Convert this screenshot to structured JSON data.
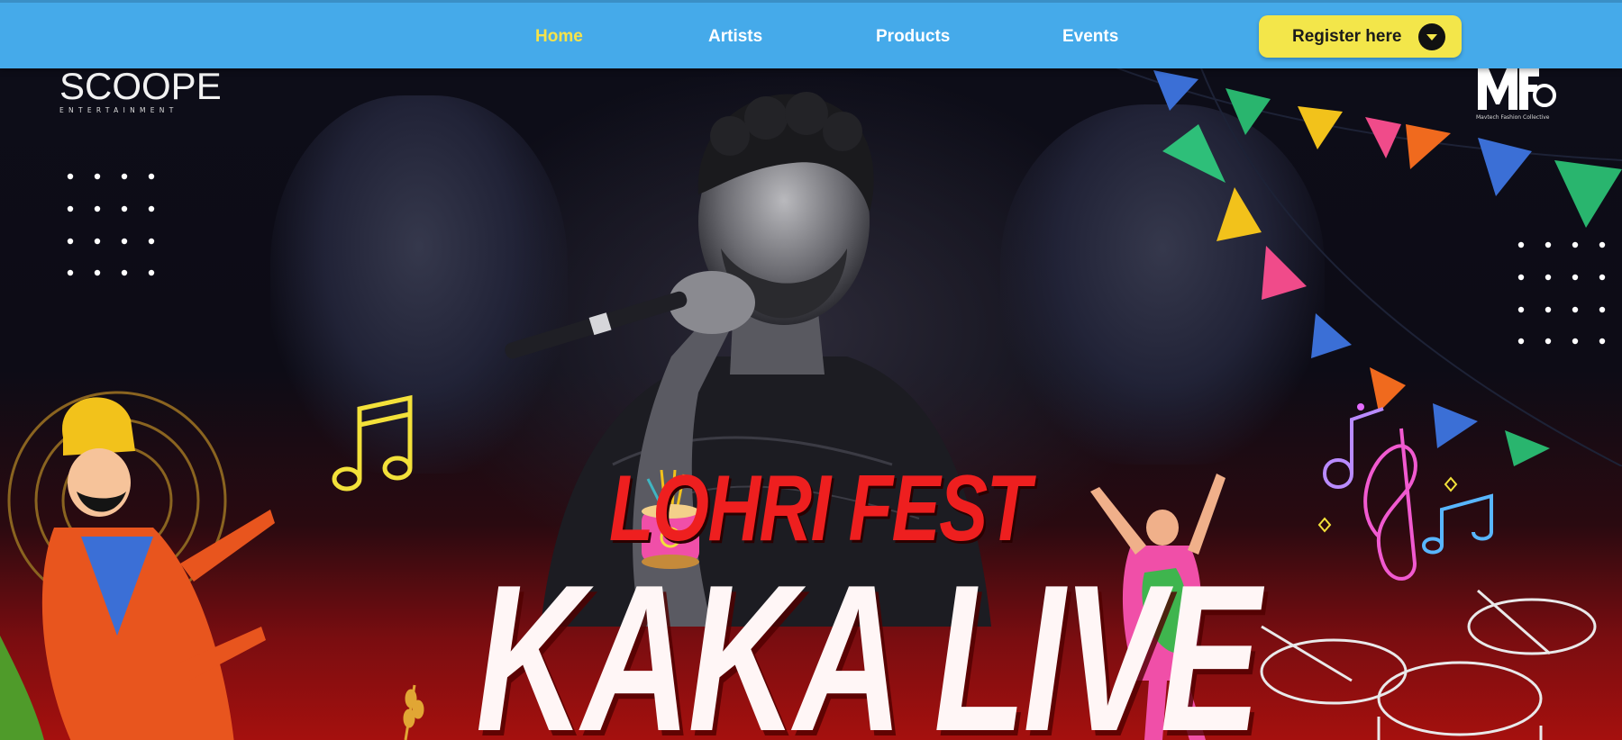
{
  "nav": {
    "links": [
      {
        "label": "Home",
        "active": true
      },
      {
        "label": "Artists",
        "active": false
      },
      {
        "label": "Products",
        "active": false
      },
      {
        "label": "Events",
        "active": false
      }
    ],
    "register_label": "Register here"
  },
  "hero": {
    "brand_left": {
      "title": "SCOOPE",
      "subtitle": "ENTERTAINMENT"
    },
    "brand_right": {
      "title": "MFC",
      "subtitle": "Mavtech Fashion Collective"
    },
    "headline_top": "LOHRI FEST",
    "headline_main": "KAKA LIVE",
    "icons": [
      "music-note-icon",
      "treble-clef-icon",
      "dhol-drum-icon",
      "bunting-flags-icon",
      "dot-grid-icon"
    ]
  },
  "colors": {
    "nav_bg": "#45aaea",
    "nav_active": "#f6e34a",
    "register_bg": "#f3e64a",
    "headline_red": "#ee1f1f"
  }
}
